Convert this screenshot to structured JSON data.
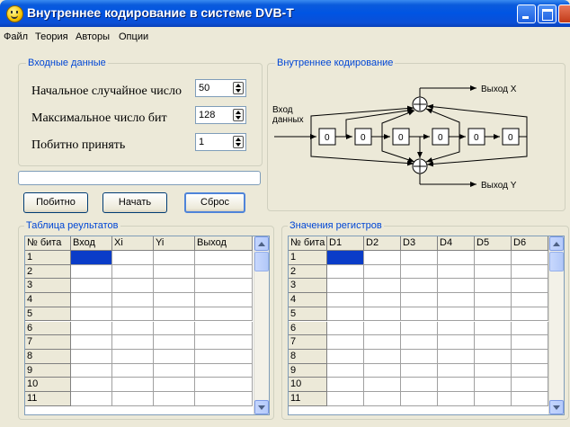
{
  "window": {
    "title": "Внутреннее кодирование в системе DVB-T"
  },
  "menu": [
    "Файл",
    "Теория",
    "Авторы",
    "Опции"
  ],
  "input_group": {
    "title": "Входные данные",
    "fields": [
      {
        "label": "Начальное случайное число",
        "value": "50"
      },
      {
        "label": "Максимальное число бит",
        "value": "128"
      },
      {
        "label": "Побитно принять",
        "value": "1"
      }
    ]
  },
  "progress": {
    "value": 0
  },
  "buttons": {
    "step": "Побитно",
    "start": "Начать",
    "reset": "Сброс"
  },
  "diagram": {
    "title": "Внутреннее кодирование",
    "input_label_1": "Вход",
    "input_label_2": "данных",
    "output_x": "Выход X",
    "output_y": "Выход Y",
    "registers": [
      "0",
      "0",
      "0",
      "0",
      "0",
      "0"
    ]
  },
  "results_table": {
    "title": "Таблица реультатов",
    "columns": [
      "№ бита",
      "Вход",
      "Xi",
      "Yi",
      "Выход"
    ],
    "rows": [
      "1",
      "2",
      "3",
      "4",
      "5",
      "6",
      "7",
      "8",
      "9",
      "10",
      "11"
    ]
  },
  "registers_table": {
    "title": "Значения регистров",
    "columns": [
      "№ бита",
      "D1",
      "D2",
      "D3",
      "D4",
      "D5",
      "D6"
    ],
    "rows": [
      "1",
      "2",
      "3",
      "4",
      "5",
      "6",
      "7",
      "8",
      "9",
      "10",
      "11"
    ]
  },
  "colors": {
    "titlebar": "#0054e3",
    "group_title": "#0046d5",
    "selection": "#0a3cc8"
  }
}
